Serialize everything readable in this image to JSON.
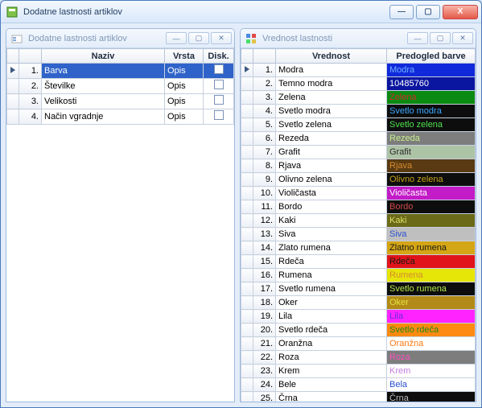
{
  "window": {
    "title": "Dodatne lastnosti artiklov",
    "controls": {
      "min": "—",
      "max": "▢",
      "close": "X"
    }
  },
  "left_panel": {
    "title": "Dodatne lastnosti artiklov",
    "headers": {
      "name": "Naziv",
      "type": "Vrsta",
      "disc": "Disk."
    },
    "rows": [
      {
        "n": "1.",
        "name": "Barva",
        "type": "Opis",
        "selected": true,
        "current": true
      },
      {
        "n": "2.",
        "name": "Številke",
        "type": "Opis"
      },
      {
        "n": "3.",
        "name": "Velikosti",
        "type": "Opis"
      },
      {
        "n": "4.",
        "name": "Način vgradnje",
        "type": "Opis"
      }
    ]
  },
  "right_panel": {
    "title": "Vrednost lastnosti",
    "headers": {
      "value": "Vrednost",
      "preview": "Predogled barve"
    },
    "rows": [
      {
        "n": "1.",
        "value": "Modra",
        "label": "Modra",
        "bg": "#1029db",
        "fg": "#6fb2ff",
        "current": true
      },
      {
        "n": "2.",
        "value": "Temno modra",
        "label": "10485760",
        "bg": "#0a15a0",
        "fg": "#ffffff"
      },
      {
        "n": "3.",
        "value": "Zelena",
        "label": "Zelena",
        "bg": "#0a8a12",
        "fg": "#d02a2a"
      },
      {
        "n": "4.",
        "value": "Svetlo modra",
        "label": "Svetlo modra",
        "bg": "#0d0d0d",
        "fg": "#3aa6ff"
      },
      {
        "n": "5.",
        "value": "Svetlo zelena",
        "label": "Svetlo zelena",
        "bg": "#0d0d0d",
        "fg": "#4ee24e"
      },
      {
        "n": "6.",
        "value": "Rezeda",
        "label": "Rezeda",
        "bg": "#7d7d7d",
        "fg": "#c6f08a"
      },
      {
        "n": "7.",
        "value": "Grafit",
        "label": "Grafit",
        "bg": "#adc3a6",
        "fg": "#2c2c2c"
      },
      {
        "n": "8.",
        "value": "Rjava",
        "label": "Rjava",
        "bg": "#5a3a12",
        "fg": "#d68a2e"
      },
      {
        "n": "9.",
        "value": "Olivno zelena",
        "label": "Olivno zelena",
        "bg": "#0d0d0d",
        "fg": "#c7a21a"
      },
      {
        "n": "10.",
        "value": "Violičasta",
        "label": "Violičasta",
        "bg": "#c21bc7",
        "fg": "#ffffff"
      },
      {
        "n": "11.",
        "value": "Bordo",
        "label": "Bordo",
        "bg": "#0d0d0d",
        "fg": "#d04a4a"
      },
      {
        "n": "12.",
        "value": "Kaki",
        "label": "Kaki",
        "bg": "#6a6a18",
        "fg": "#dede68"
      },
      {
        "n": "13.",
        "value": "Siva",
        "label": "Siva",
        "bg": "#bfbfbf",
        "fg": "#2a4fd0"
      },
      {
        "n": "14.",
        "value": "Zlato rumena",
        "label": "Zlatno rumena",
        "bg": "#d4a514",
        "fg": "#1a1a1a"
      },
      {
        "n": "15.",
        "value": "Rdeča",
        "label": "Rdeča",
        "bg": "#e0141a",
        "fg": "#1a1a1a"
      },
      {
        "n": "16.",
        "value": "Rumena",
        "label": "Rumena",
        "bg": "#e6e609",
        "fg": "#d68a2e"
      },
      {
        "n": "17.",
        "value": "Svetlo rumena",
        "label": "Svetlo rumena",
        "bg": "#0d0d0d",
        "fg": "#b5e84a"
      },
      {
        "n": "18.",
        "value": "Oker",
        "label": "Oker",
        "bg": "#b28a17",
        "fg": "#e6e240"
      },
      {
        "n": "19.",
        "value": "Lila",
        "label": "Lila",
        "bg": "#ff23ff",
        "fg": "#6a2ae0"
      },
      {
        "n": "20.",
        "value": "Svetlo rdeča",
        "label": "Svetlo rdeča",
        "bg": "#ff8a12",
        "fg": "#1a8a1a"
      },
      {
        "n": "21.",
        "value": "Oranžna",
        "label": "Oranžna",
        "bg": "#ffffff",
        "fg": "#ff7a12"
      },
      {
        "n": "22.",
        "value": "Roza",
        "label": "Roza",
        "bg": "#7d7d7d",
        "fg": "#ff4fc2"
      },
      {
        "n": "23.",
        "value": "Krem",
        "label": "Krem",
        "bg": "#ffffff",
        "fg": "#c77ae0"
      },
      {
        "n": "24.",
        "value": "Bele",
        "label": "Bela",
        "bg": "#ffffff",
        "fg": "#2a4fd0"
      },
      {
        "n": "25.",
        "value": "Črna",
        "label": "Črna",
        "bg": "#0d0d0d",
        "fg": "#bcbcbc"
      }
    ]
  }
}
